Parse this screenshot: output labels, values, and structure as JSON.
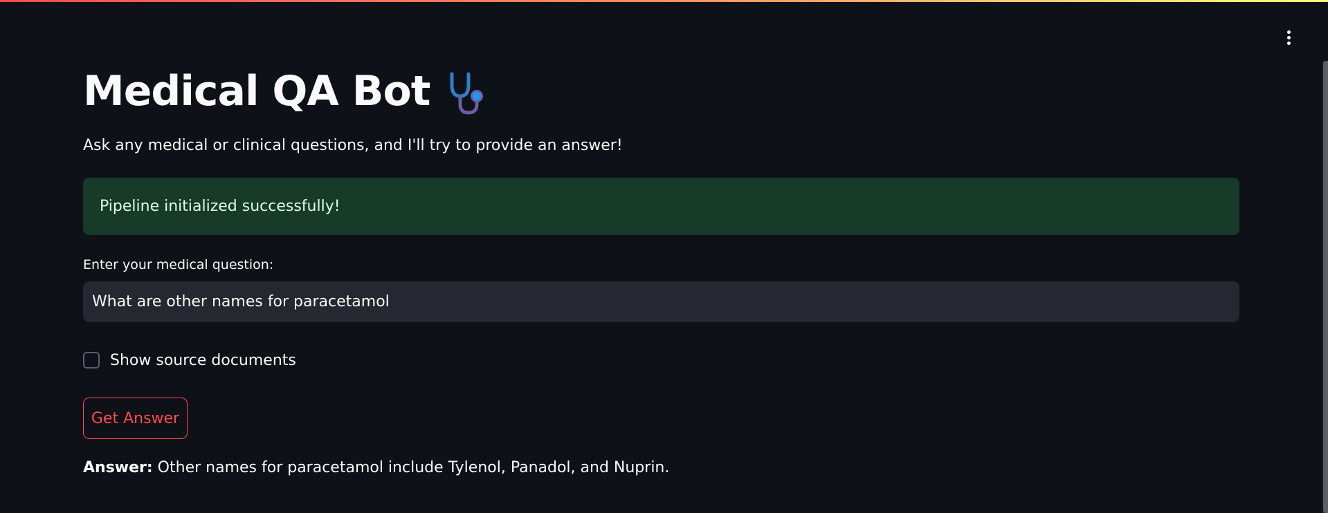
{
  "app": {
    "title": "Medical QA Bot",
    "title_icon": "stethoscope-icon",
    "subtitle": "Ask any medical or clinical questions, and I'll try to provide an answer!"
  },
  "header": {
    "menu_icon": "kebab-menu-icon"
  },
  "status": {
    "message": "Pipeline initialized successfully!",
    "color": "#173a29"
  },
  "question": {
    "label": "Enter your medical question:",
    "value": "What are other names for paracetamol"
  },
  "options": {
    "show_sources_label": "Show source documents",
    "show_sources_checked": false
  },
  "actions": {
    "get_answer_label": "Get Answer",
    "accent_color": "#ff4b4b"
  },
  "answer": {
    "prefix": "Answer:",
    "text": " Other names for paracetamol include Tylenol, Panadol, and Nuprin."
  }
}
